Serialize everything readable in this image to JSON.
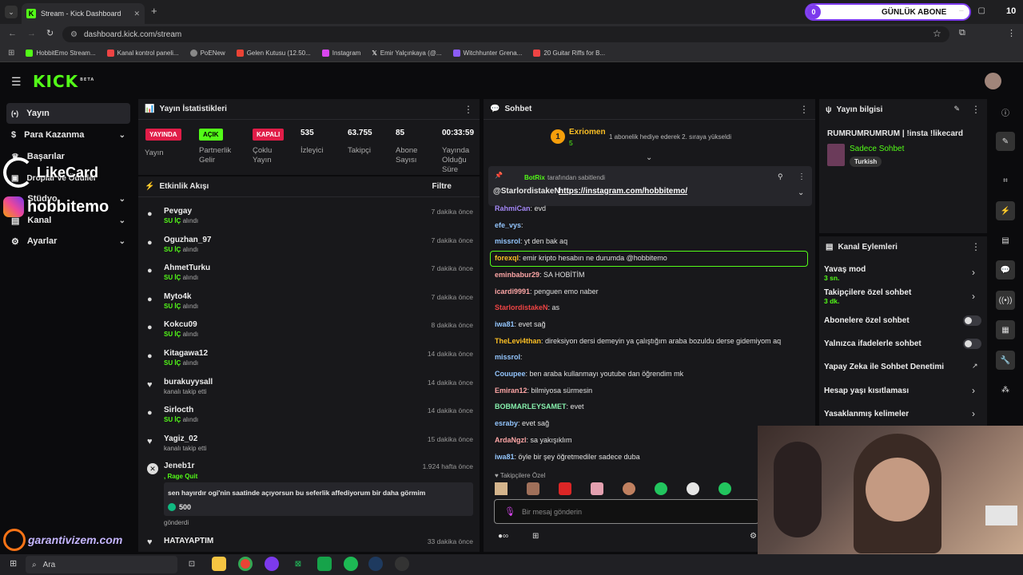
{
  "browser": {
    "tab_title": "Stream - Kick Dashboard",
    "url": "dashboard.kick.com/stream",
    "bookmarks": [
      "HobbitEmo Stream...",
      "Kanal kontrol paneli...",
      "PoENew",
      "Gelen Kutusu (12.50...",
      "Instagram",
      "Emir Yalçınkaya (@...",
      "Witchhunter Grena...",
      "20 Guitar Riffs for B..."
    ],
    "overlay": {
      "count": "0",
      "label": "GÜNLÜK ABONE",
      "right": "10"
    }
  },
  "kick": {
    "logo": "KICK",
    "beta": "BETA"
  },
  "sidebar": {
    "items": [
      {
        "label": "Yayın"
      },
      {
        "label": "Para Kazanma"
      },
      {
        "label": "Başarılar"
      },
      {
        "label": "Droplar ve Ödüller"
      },
      {
        "label": "Stüdyo"
      },
      {
        "label": "Kanal"
      },
      {
        "label": "Ayarlar"
      }
    ]
  },
  "overlays": {
    "likecard": "LikeCard",
    "hobbitemo": "hobbitemo",
    "garantivizem": "garantivizem.com"
  },
  "stats": {
    "title": "Yayın İstatistikleri",
    "b1": "YAYINDA",
    "b1l": "Yayın",
    "b2": "AÇIK",
    "b2l": "Partnerlik Gelir",
    "b3": "KAPALI",
    "b3l": "Çoklu Yayın",
    "n1": "535",
    "n1l": "İzleyici",
    "n2": "63.755",
    "n2l": "Takipçi",
    "n3": "85",
    "n3l": "Abone Sayısı",
    "n4": "00:33:59",
    "n4l": "Yayında Olduğu Süre"
  },
  "activity": {
    "title": "Etkinlik Akışı",
    "filter": "Filtre",
    "items": [
      {
        "name": "Pevgay",
        "a": "SU İÇ",
        "b": "alındı",
        "time": "7 dakika önce"
      },
      {
        "name": "Oguzhan_97",
        "a": "SU İÇ",
        "b": "alındı",
        "time": "7 dakika önce"
      },
      {
        "name": "AhmetTurku",
        "a": "SU İÇ",
        "b": "alındı",
        "time": "7 dakika önce"
      },
      {
        "name": "Myto4k",
        "a": "SU İÇ",
        "b": "alındı",
        "time": "7 dakika önce"
      },
      {
        "name": "Kokcu09",
        "a": "SU İÇ",
        "b": "alındı",
        "time": "8 dakika önce"
      },
      {
        "name": "Kitagawa12",
        "a": "SU İÇ",
        "b": "alındı",
        "time": "14 dakika önce"
      },
      {
        "name": "burakuyysall",
        "a": "",
        "b": "kanalı takip etti",
        "time": "14 dakika önce"
      },
      {
        "name": "Sirlocth",
        "a": "SU İÇ",
        "b": "alındı",
        "time": "14 dakika önce"
      },
      {
        "name": "Yagiz_02",
        "a": "",
        "b": "kanalı takip etti",
        "time": "15 dakika önce"
      }
    ],
    "jeneb": {
      "name": "Jeneb1r",
      "reward": ", Rage Quit",
      "time": "1.924 hafta önce",
      "message": "sen hayırdır ogi'nin saatinde açıyorsun bu seferlik affediyorum bir daha görmim",
      "amount": "500",
      "sent": "gönderdi"
    },
    "last": {
      "name": "HATAYAPTIM",
      "time": "33 dakika önce"
    }
  },
  "chat": {
    "title": "Sohbet",
    "top_user": "Exriomen",
    "top_count": "5",
    "gift_text": "1 abonelik hediye ederek 2. sıraya yükseldi",
    "pinned_by": "BotRix",
    "pinned_label": "tarafından sabitlendi",
    "pinned_user": "@StarlordistakeN",
    "pinned_link": "https://instagram.com/hobbitemo/",
    "messages": [
      {
        "u": "RahmiCan",
        "t": "evd",
        "c": "#a78bfa"
      },
      {
        "u": "efe_vys",
        "t": "",
        "c": "#93c5fd"
      },
      {
        "u": "missrol",
        "t": "yt den bak aq",
        "c": "#93c5fd"
      },
      {
        "u": "forexql",
        "t": "emir kripto hesabın ne durumda @hobbitemo",
        "c": "#fbbf24"
      },
      {
        "u": "eminbabur29",
        "t": "SA HOBİTİM",
        "c": "#fca5a5"
      },
      {
        "u": "icardi9991",
        "t": "penguen emo naber",
        "c": "#fca5a5"
      },
      {
        "u": "StarlordistakeN",
        "t": "as",
        "c": "#ef4444"
      },
      {
        "u": "iwa81",
        "t": "evet sağ",
        "c": "#93c5fd"
      },
      {
        "u": "TheLevi4than",
        "t": "direksiyon dersi demeyin ya çalıştığım araba bozuldu derse gidemiyom aq",
        "c": "#fbbf24"
      },
      {
        "u": "missrol",
        "t": "",
        "c": "#93c5fd"
      },
      {
        "u": "Couupee",
        "t": "ben araba kullanmayı youtube dan öğrendim mk",
        "c": "#93c5fd"
      },
      {
        "u": "Emiran12",
        "t": "bilmiyosa sürmesin",
        "c": "#fca5a5"
      },
      {
        "u": "BOBMARLEYSAMET",
        "t": "evet",
        "c": "#86efac"
      },
      {
        "u": "esraby",
        "t": "evet sağ",
        "c": "#93c5fd"
      },
      {
        "u": "ArdaNgzl",
        "t": "sa yakışıklım",
        "c": "#fca5a5"
      },
      {
        "u": "iwa81",
        "t": "öyle bir şey öğretmediler sadece duba",
        "c": "#93c5fd"
      }
    ],
    "followers_label": "Takipçilere Özel",
    "input_placeholder": "Bir mesaj gönderin"
  },
  "info": {
    "title": "Yayın bilgisi",
    "stream_title": "RUMRUMRUMRUM | !insta !likecard",
    "category": "Sadece Sohbet",
    "language": "Turkish"
  },
  "actions": {
    "title": "Kanal Eylemleri",
    "items": [
      {
        "label": "Yavaş mod",
        "sub": "3 sn."
      },
      {
        "label": "Takipçilere özel sohbet",
        "sub": "3 dk."
      },
      {
        "label": "Abonelere özel sohbet",
        "sub": ""
      },
      {
        "label": "Yalnızca ifadelerle sohbet",
        "sub": ""
      },
      {
        "label": "Yapay Zeka ile Sohbet Denetimi",
        "sub": ""
      },
      {
        "label": "Hesap yaşı kısıtlaması",
        "sub": ""
      },
      {
        "label": "Yasaklanmış kelimeler",
        "sub": ""
      }
    ]
  },
  "taskbar": {
    "search": "Ara"
  },
  "colors": {
    "accent": "#53fc18",
    "panel": "#18181b",
    "live": "#e11d48"
  }
}
